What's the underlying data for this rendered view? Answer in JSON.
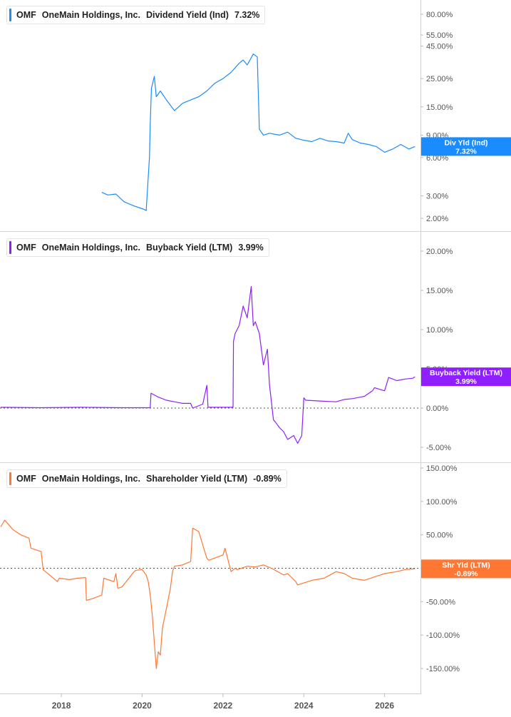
{
  "colors": {
    "dividend": "#1a8cff",
    "buyback": "#8f1fff",
    "shareholder": "#ff7733"
  },
  "panels": [
    {
      "ticker": "OMF",
      "company": "OneMain Holdings, Inc.",
      "metric": "Dividend Yield (Ind)",
      "value": "7.32%",
      "tag_line1": "Div Yld (Ind)",
      "tag_line2": "7.32%"
    },
    {
      "ticker": "OMF",
      "company": "OneMain Holdings, Inc.",
      "metric": "Buyback Yield (LTM)",
      "value": "3.99%",
      "tag_line1": "Buyback Yield (LTM)",
      "tag_line2": "3.99%"
    },
    {
      "ticker": "OMF",
      "company": "OneMain Holdings, Inc.",
      "metric": "Shareholder Yield (LTM)",
      "value": "-0.89%",
      "tag_line1": "Shr Yld (LTM)",
      "tag_line2": "-0.89%"
    }
  ],
  "chart_data": [
    {
      "type": "line",
      "scale": "log",
      "series": [
        {
          "name": "Dividend Yield (Ind)",
          "x": [
            2019.0,
            2019.15,
            2019.35,
            2019.55,
            2019.8,
            2020.05,
            2020.1,
            2020.18,
            2020.2,
            2020.23,
            2020.3,
            2020.35,
            2020.45,
            2020.6,
            2020.8,
            2021.0,
            2021.2,
            2021.4,
            2021.6,
            2021.8,
            2022.0,
            2022.2,
            2022.4,
            2022.5,
            2022.6,
            2022.75,
            2022.85,
            2022.9,
            2023.0,
            2023.15,
            2023.4,
            2023.6,
            2023.8,
            2024.0,
            2024.2,
            2024.4,
            2024.6,
            2024.8,
            2025.0,
            2025.1,
            2025.2,
            2025.4,
            2025.6,
            2025.8,
            2026.0,
            2026.2,
            2026.4,
            2026.6,
            2026.75
          ],
          "values": [
            3.2,
            3.05,
            3.1,
            2.7,
            2.5,
            2.35,
            2.3,
            6.0,
            11,
            21,
            26,
            18,
            20,
            17,
            14,
            16,
            17,
            18,
            20,
            23,
            25,
            28,
            33,
            35,
            32,
            39,
            37,
            10,
            9.0,
            9.3,
            9.0,
            9.5,
            8.5,
            8.2,
            8.0,
            8.5,
            8.1,
            8.0,
            7.8,
            9.3,
            8.3,
            7.8,
            7.6,
            7.3,
            6.6,
            7.0,
            7.6,
            7.0,
            7.32
          ]
        }
      ],
      "y_ticks": [
        "80.00%",
        "55.00%",
        "45.00%",
        "25.00%",
        "15.00%",
        "9.00%",
        "6.00%",
        "3.00%",
        "2.00%"
      ],
      "y_tick_values": [
        80,
        55,
        45,
        25,
        15,
        9,
        6,
        3,
        2
      ]
    },
    {
      "type": "line",
      "series": [
        {
          "name": "Buyback Yield (LTM)",
          "x": [
            2016.5,
            2017.5,
            2018.5,
            2019.5,
            2020.2,
            2020.22,
            2020.4,
            2020.6,
            2020.8,
            2021.0,
            2021.2,
            2021.25,
            2021.5,
            2021.6,
            2021.63,
            2022.0,
            2022.05,
            2022.25,
            2022.26,
            2022.3,
            2022.4,
            2022.5,
            2022.6,
            2022.7,
            2022.75,
            2022.8,
            2022.9,
            2023.0,
            2023.1,
            2023.15,
            2023.25,
            2023.3,
            2023.4,
            2023.5,
            2023.6,
            2023.75,
            2023.85,
            2023.95,
            2024.0,
            2024.05,
            2024.4,
            2024.8,
            2025.0,
            2025.2,
            2025.5,
            2025.7,
            2025.75,
            2026.0,
            2026.1,
            2026.3,
            2026.5,
            2026.7,
            2026.75
          ],
          "values": [
            0.1,
            0.05,
            0.1,
            0.05,
            0.05,
            1.9,
            1.4,
            1.0,
            0.8,
            0.6,
            0.6,
            0.0,
            0.5,
            2.9,
            0.1,
            0.1,
            0.1,
            0.1,
            8.5,
            9.5,
            10.5,
            13.0,
            11.5,
            15.5,
            10.5,
            11.0,
            9.5,
            5.5,
            7.5,
            3.0,
            -1.5,
            -1.8,
            -2.5,
            -3.0,
            -4.0,
            -3.5,
            -4.5,
            -3.5,
            1.3,
            1.0,
            0.9,
            0.8,
            1.1,
            1.2,
            1.5,
            2.2,
            2.6,
            2.2,
            3.9,
            3.5,
            3.7,
            3.8,
            3.99
          ]
        }
      ],
      "y_ticks": [
        "20.00%",
        "15.00%",
        "10.00%",
        "5.00%",
        "0.00%",
        "-5.00%"
      ],
      "y_tick_values": [
        20,
        15,
        10,
        5,
        0,
        -5
      ],
      "zero_line": 0
    },
    {
      "type": "line",
      "series": [
        {
          "name": "Shareholder Yield (LTM)",
          "x": [
            2016.5,
            2016.6,
            2016.8,
            2017.0,
            2017.2,
            2017.25,
            2017.5,
            2017.55,
            2017.9,
            2017.95,
            2018.2,
            2018.4,
            2018.6,
            2018.62,
            2018.8,
            2019.0,
            2019.05,
            2019.3,
            2019.35,
            2019.4,
            2019.5,
            2019.8,
            2019.85,
            2020.0,
            2020.1,
            2020.15,
            2020.2,
            2020.25,
            2020.3,
            2020.35,
            2020.4,
            2020.45,
            2020.5,
            2020.6,
            2020.7,
            2020.75,
            2020.8,
            2021.0,
            2021.2,
            2021.25,
            2021.4,
            2021.6,
            2021.65,
            2022.0,
            2022.05,
            2022.2,
            2022.3,
            2022.35,
            2022.6,
            2022.8,
            2023.0,
            2023.2,
            2023.5,
            2023.6,
            2023.8,
            2023.85,
            2024.2,
            2024.5,
            2024.8,
            2025.0,
            2025.2,
            2025.5,
            2025.8,
            2026.0,
            2026.3,
            2026.5,
            2026.75
          ],
          "values": [
            62,
            72,
            58,
            50,
            45,
            30,
            25,
            -2,
            -20,
            -15,
            -17,
            -15,
            -14,
            -48,
            -45,
            -40,
            -15,
            -20,
            -8,
            -30,
            -28,
            -5,
            -3,
            -2,
            -10,
            -20,
            -40,
            -70,
            -110,
            -150,
            -125,
            -130,
            -90,
            -60,
            -30,
            -5,
            3,
            5,
            10,
            60,
            55,
            15,
            12,
            20,
            30,
            -5,
            0,
            -2,
            3,
            2,
            5,
            0,
            -10,
            -8,
            -20,
            -25,
            -18,
            -15,
            -5,
            -8,
            -15,
            -18,
            -12,
            -8,
            -5,
            -2,
            -0.89
          ]
        }
      ],
      "y_ticks": [
        "150.00%",
        "100.00%",
        "50.00%",
        "0.00%",
        "-50.00%",
        "-100.00%",
        "-150.00%"
      ],
      "y_tick_values": [
        150,
        100,
        50,
        0,
        -50,
        -100,
        -150
      ],
      "zero_line": 0
    }
  ],
  "x_axis": {
    "ticks": [
      "2018",
      "2020",
      "2022",
      "2024",
      "2026"
    ],
    "tick_values": [
      2018,
      2020,
      2022,
      2024,
      2026
    ]
  }
}
